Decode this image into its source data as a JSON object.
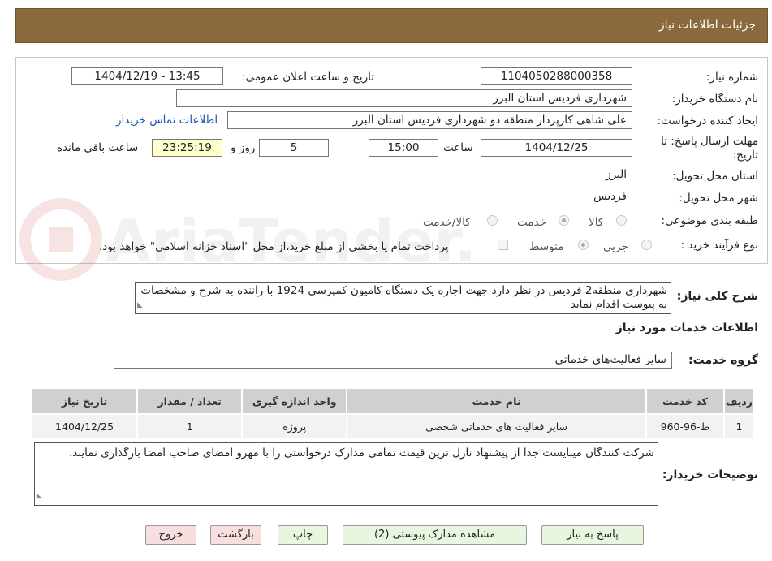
{
  "header": {
    "title": "جزئیات اطلاعات نیاز"
  },
  "need_number": {
    "label": "شماره نیاز:",
    "value": "1104050288000358"
  },
  "announce": {
    "label": "تاریخ و ساعت اعلان عمومی:",
    "value": "1404/12/19 - 13:45"
  },
  "buyer_org": {
    "label": "نام دستگاه خریدار:",
    "value": "شهرداری فردیس استان البرز"
  },
  "requester": {
    "label": "ایجاد کننده درخواست:",
    "value": "علی شاهی کارپرداز منطقه دو شهرداری فردیس استان البرز",
    "contact_link": "اطلاعات تماس خریدار"
  },
  "deadline": {
    "label_line1": "مهلت ارسال پاسخ: تا",
    "label_line2": "تاریخ:",
    "date": "1404/12/25",
    "time_label": "ساعت",
    "time": "15:00",
    "days": "5",
    "days_label": "روز و",
    "remaining": "23:25:19",
    "remaining_label": "ساعت باقی مانده"
  },
  "province": {
    "label": "استان محل تحویل:",
    "value": "البرز"
  },
  "city": {
    "label": "شهر محل تحویل:",
    "value": "فردیس"
  },
  "category": {
    "label": "طبقه بندی موضوعی:",
    "options": [
      "کالا",
      "خدمت",
      "کالا/خدمت"
    ],
    "selected": "خدمت"
  },
  "process": {
    "label": "نوع فرآیند خرید :",
    "options": [
      "جزیی",
      "متوسط"
    ],
    "selected": "متوسط",
    "payment_note": "پرداخت تمام یا بخشی از مبلغ خرید،از محل \"اسناد خزانه اسلامی\" خواهد بود."
  },
  "description": {
    "label": "شرح کلی نیاز:",
    "value": "شهرداری منطقه2 فردیس در نظر دارد جهت اجاره یک دستگاه کامیون کمپرسی 1924 با راننده به شرح و مشخصات به پیوست اقدام نماید"
  },
  "services_info": {
    "title": "اطلاعات خدمات مورد نیاز"
  },
  "service_group": {
    "label": "گروه خدمت:",
    "value": "سایر فعالیت‌های خدماتی"
  },
  "table": {
    "headers": [
      "ردیف",
      "کد خدمت",
      "نام خدمت",
      "واحد اندازه گیری",
      "تعداد / مقدار",
      "تاریخ نیاز"
    ],
    "rows": [
      [
        "1",
        "ط-96-960",
        "سایر فعالیت های خدماتی شخصی",
        "پروژه",
        "1",
        "1404/12/25"
      ]
    ]
  },
  "buyer_notes": {
    "label": "توضیحات خریدار:",
    "value": "شرکت کنندگان میبایست جدا از پیشنهاد نازل ترین قیمت تمامی مدارک درخواستی را با مهرو امضای صاحب امضا بارگذاری نمایند."
  },
  "buttons": {
    "reply": "پاسخ به نیاز",
    "attachments": "مشاهده مدارک پیوستی (2)",
    "print": "چاپ",
    "back": "بازگشت",
    "exit": "خروج"
  },
  "watermark": {
    "text": "AriaTender.neT"
  },
  "colors": {
    "header_bg": "#8a6a3d",
    "button_green": "#e8f5df",
    "button_red": "#f7dfe0",
    "link": "#1a56b4"
  }
}
